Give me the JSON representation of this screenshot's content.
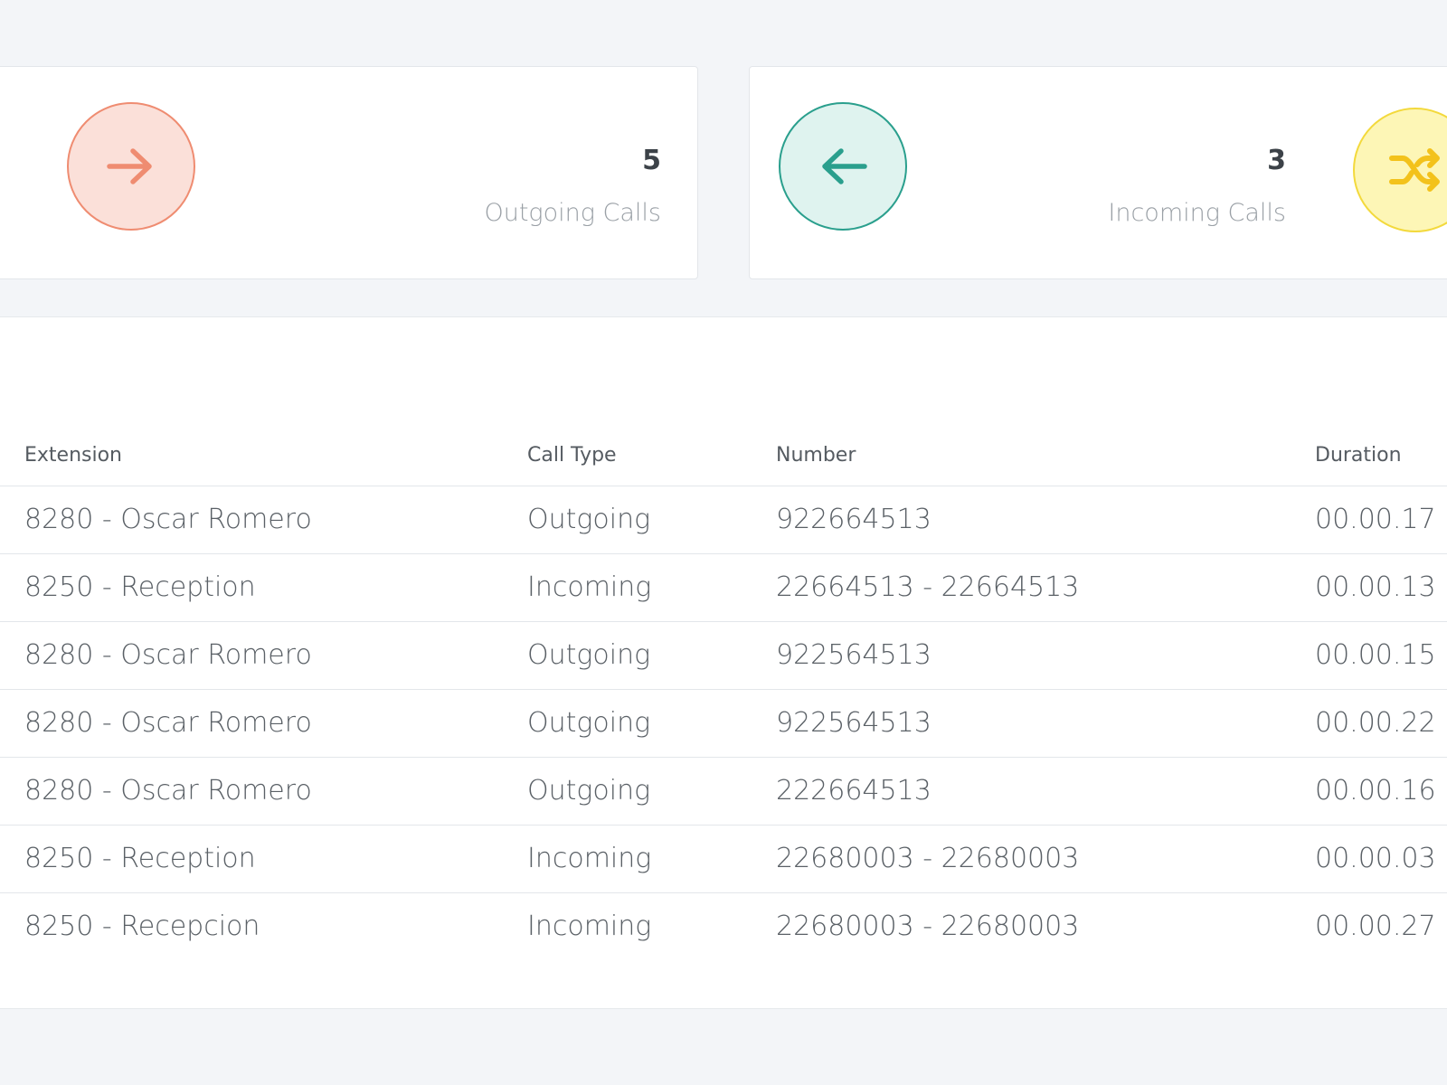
{
  "stats": {
    "outgoing": {
      "value": "5",
      "label": "Outgoing Calls",
      "color": "#ef8c71",
      "icon": "arrow-right-icon"
    },
    "incoming": {
      "value": "3",
      "label": "Incoming Calls",
      "color": "#2a9f8d",
      "icon": "arrow-left-icon"
    },
    "mixed": {
      "color": "#f3c21b",
      "icon": "shuffle-icon"
    }
  },
  "table": {
    "headers": {
      "extension": "Extension",
      "call_type": "Call Type",
      "number": "Number",
      "duration": "Duration"
    },
    "rows": [
      {
        "extension": "8280 - Oscar Romero",
        "call_type": "Outgoing",
        "number": "922664513",
        "duration": "00.00.17"
      },
      {
        "extension": "8250 - Reception",
        "call_type": "Incoming",
        "number": "22664513 - 22664513",
        "duration": "00.00.13"
      },
      {
        "extension": "8280 - Oscar Romero",
        "call_type": "Outgoing",
        "number": "922564513",
        "duration": "00.00.15"
      },
      {
        "extension": "8280 - Oscar Romero",
        "call_type": "Outgoing",
        "number": "922564513",
        "duration": "00.00.22"
      },
      {
        "extension": "8280 - Oscar Romero",
        "call_type": "Outgoing",
        "number": "222664513",
        "duration": "00.00.16"
      },
      {
        "extension": "8250 - Reception",
        "call_type": "Incoming",
        "number": "22680003 - 22680003",
        "duration": "00.00.03"
      },
      {
        "extension": "8250 - Recepcion",
        "call_type": "Incoming",
        "number": "22680003 - 22680003",
        "duration": "00.00.27"
      }
    ]
  }
}
